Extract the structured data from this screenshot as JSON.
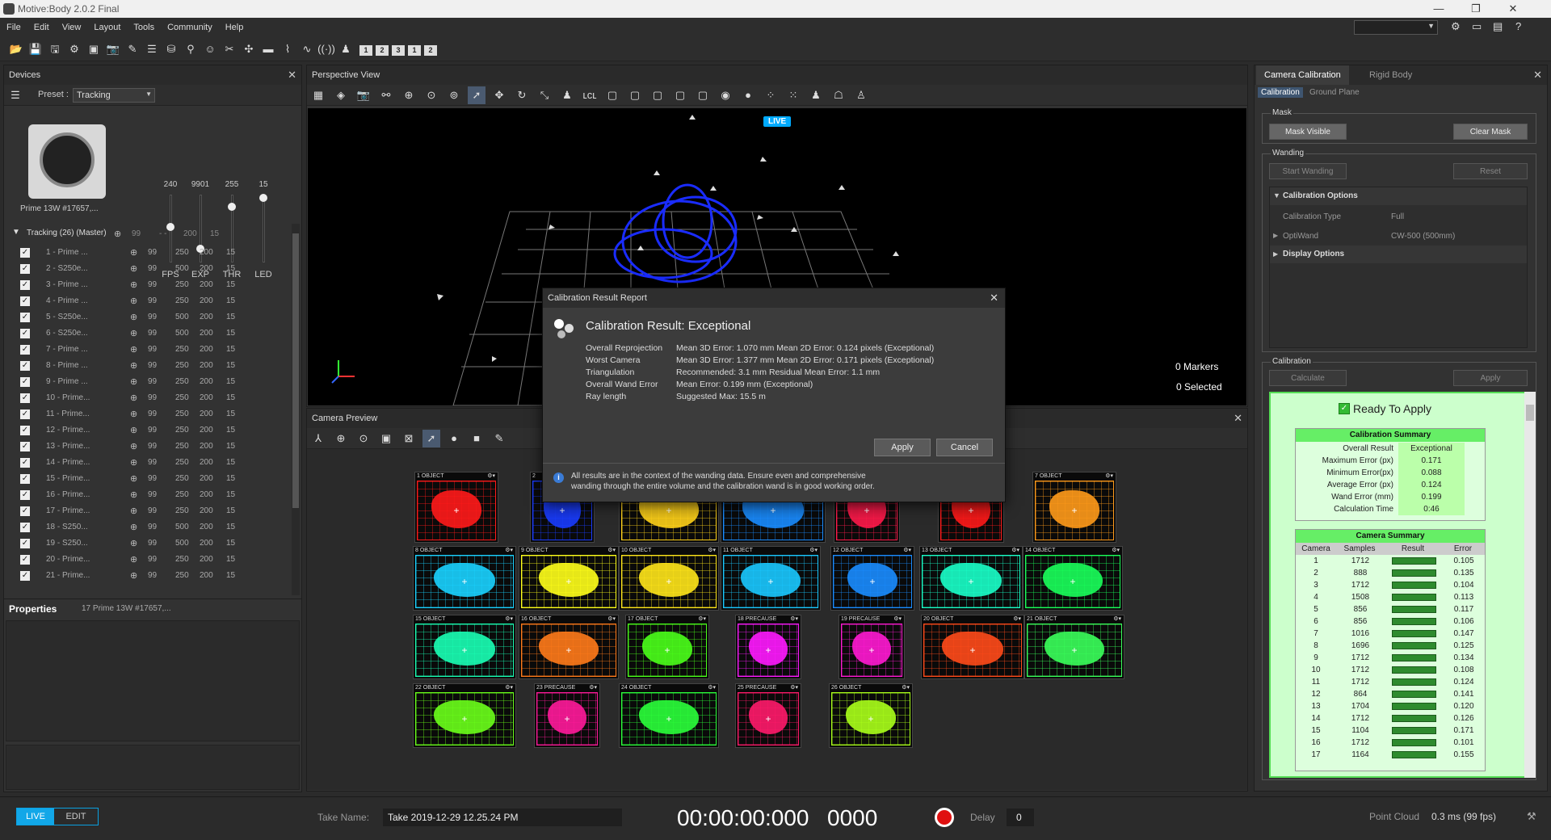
{
  "window": {
    "title": "Motive:Body 2.0.2 Final"
  },
  "menu": [
    "File",
    "Edit",
    "View",
    "Layout",
    "Tools",
    "Community",
    "Help"
  ],
  "toolbar_numbers": [
    "1",
    "2",
    "3",
    "1",
    "2"
  ],
  "devices": {
    "title": "Devices",
    "preset_label": "Preset :",
    "preset_value": "Tracking",
    "camera_name": "Prime 13W #17657,...",
    "sliders": [
      {
        "label": "FPS",
        "value": "240",
        "level": 0.52
      },
      {
        "label": "EXP",
        "value": "9901",
        "level": 0.2
      },
      {
        "label": "THR",
        "value": "255",
        "level": 0.82
      },
      {
        "label": "LED",
        "value": "15",
        "level": 0.95
      }
    ],
    "group_label": "Tracking (26) (Master)",
    "group_cols": [
      "99",
      "- -",
      "200",
      "15"
    ],
    "rows": [
      {
        "name": "1 - Prime ...",
        "fps": "99",
        "exp": "250",
        "thr": "200",
        "led": "15"
      },
      {
        "name": "2 - S250e...",
        "fps": "99",
        "exp": "500",
        "thr": "200",
        "led": "15"
      },
      {
        "name": "3 - Prime ...",
        "fps": "99",
        "exp": "250",
        "thr": "200",
        "led": "15"
      },
      {
        "name": "4 - Prime ...",
        "fps": "99",
        "exp": "250",
        "thr": "200",
        "led": "15"
      },
      {
        "name": "5 - S250e...",
        "fps": "99",
        "exp": "500",
        "thr": "200",
        "led": "15"
      },
      {
        "name": "6 - S250e...",
        "fps": "99",
        "exp": "500",
        "thr": "200",
        "led": "15"
      },
      {
        "name": "7 - Prime ...",
        "fps": "99",
        "exp": "250",
        "thr": "200",
        "led": "15"
      },
      {
        "name": "8 - Prime ...",
        "fps": "99",
        "exp": "250",
        "thr": "200",
        "led": "15"
      },
      {
        "name": "9 - Prime ...",
        "fps": "99",
        "exp": "250",
        "thr": "200",
        "led": "15"
      },
      {
        "name": "10 - Prime...",
        "fps": "99",
        "exp": "250",
        "thr": "200",
        "led": "15"
      },
      {
        "name": "11 - Prime...",
        "fps": "99",
        "exp": "250",
        "thr": "200",
        "led": "15"
      },
      {
        "name": "12 - Prime...",
        "fps": "99",
        "exp": "250",
        "thr": "200",
        "led": "15"
      },
      {
        "name": "13 - Prime...",
        "fps": "99",
        "exp": "250",
        "thr": "200",
        "led": "15"
      },
      {
        "name": "14 - Prime...",
        "fps": "99",
        "exp": "250",
        "thr": "200",
        "led": "15"
      },
      {
        "name": "15 - Prime...",
        "fps": "99",
        "exp": "250",
        "thr": "200",
        "led": "15"
      },
      {
        "name": "16 - Prime...",
        "fps": "99",
        "exp": "250",
        "thr": "200",
        "led": "15"
      },
      {
        "name": "17 - Prime...",
        "fps": "99",
        "exp": "250",
        "thr": "200",
        "led": "15"
      },
      {
        "name": "18 - S250...",
        "fps": "99",
        "exp": "500",
        "thr": "200",
        "led": "15"
      },
      {
        "name": "19 - S250...",
        "fps": "99",
        "exp": "500",
        "thr": "200",
        "led": "15"
      },
      {
        "name": "20 - Prime...",
        "fps": "99",
        "exp": "250",
        "thr": "200",
        "led": "15"
      },
      {
        "name": "21 - Prime...",
        "fps": "99",
        "exp": "250",
        "thr": "200",
        "led": "15"
      }
    ]
  },
  "properties": {
    "title": "Properties",
    "subject": "17 Prime 13W #17657,..."
  },
  "perspective": {
    "title": "Perspective View",
    "live_badge": "LIVE",
    "markers": "0 Markers",
    "selected": "0 Selected"
  },
  "camera_preview": {
    "title": "Camera Preview",
    "tiles": [
      {
        "id": "1",
        "tag": "OBJECT",
        "color": "#ff1a1a"
      },
      {
        "id": "2",
        "tag": "",
        "color": "#1a3cff"
      },
      {
        "id": "3",
        "tag": "",
        "color": "#ffd21a"
      },
      {
        "id": "4",
        "tag": "",
        "color": "#1a8cff"
      },
      {
        "id": "5",
        "tag": "",
        "color": "#ff1a4a"
      },
      {
        "id": "6",
        "tag": "",
        "color": "#ff1a1a"
      },
      {
        "id": "7",
        "tag": "OBJECT",
        "color": "#ff9a1a"
      },
      {
        "id": "8",
        "tag": "OBJECT",
        "color": "#1ad2ff"
      },
      {
        "id": "9",
        "tag": "OBJECT",
        "color": "#ffff1a"
      },
      {
        "id": "10",
        "tag": "OBJECT",
        "color": "#ffe61a"
      },
      {
        "id": "11",
        "tag": "OBJECT",
        "color": "#1ac8ff"
      },
      {
        "id": "12",
        "tag": "OBJECT",
        "color": "#1a8cff"
      },
      {
        "id": "13",
        "tag": "OBJECT",
        "color": "#1affc8"
      },
      {
        "id": "14",
        "tag": "OBJECT",
        "color": "#1aff5a"
      },
      {
        "id": "15",
        "tag": "OBJECT",
        "color": "#1affb4"
      },
      {
        "id": "16",
        "tag": "OBJECT",
        "color": "#ff7a1a"
      },
      {
        "id": "17",
        "tag": "OBJECT",
        "color": "#4aff1a"
      },
      {
        "id": "18",
        "tag": "PRECAUSE",
        "color": "#ff1aff"
      },
      {
        "id": "19",
        "tag": "PRECAUSE",
        "color": "#ff1ad2"
      },
      {
        "id": "20",
        "tag": "OBJECT",
        "color": "#ff4a1a"
      },
      {
        "id": "21",
        "tag": "OBJECT",
        "color": "#3aff5a"
      },
      {
        "id": "22",
        "tag": "OBJECT",
        "color": "#6aff1a"
      },
      {
        "id": "23",
        "tag": "PRECAUSE",
        "color": "#ff1a9a"
      },
      {
        "id": "24",
        "tag": "OBJECT",
        "color": "#2aff3a"
      },
      {
        "id": "25",
        "tag": "PRECAUSE",
        "color": "#ff1a6a"
      },
      {
        "id": "26",
        "tag": "OBJECT",
        "color": "#aaff1a"
      }
    ]
  },
  "dialog": {
    "title": "Calibration Result Report",
    "heading": "Calibration Result: Exceptional",
    "rows": [
      [
        "Overall Reprojection",
        "Mean 3D Error: 1.070 mm  Mean 2D Error: 0.124 pixels (Exceptional)"
      ],
      [
        "Worst Camera",
        "Mean 3D Error: 1.377 mm  Mean 2D Error: 0.171 pixels (Exceptional)"
      ],
      [
        "Triangulation",
        "Recommended: 3.1 mm    Residual Mean Error: 1.1 mm"
      ],
      [
        "Overall Wand Error",
        "Mean Error: 0.199 mm     (Exceptional)"
      ],
      [
        "Ray length",
        "Suggested Max: 15.5 m"
      ]
    ],
    "apply": "Apply",
    "cancel": "Cancel",
    "note": "All results are in the context of the wanding data.  Ensure even and comprehensive wanding through the entire volume and the calibration wand is in good working order."
  },
  "calibration_panel": {
    "tabs": [
      "Camera Calibration",
      "Rigid Body"
    ],
    "subtabs": [
      "Calibration",
      "Ground Plane"
    ],
    "mask_label": "Mask",
    "mask_visible": "Mask Visible",
    "clear_mask": "Clear Mask",
    "wanding_label": "Wanding",
    "start_wanding": "Start Wanding",
    "reset": "Reset",
    "calib_options": "Calibration Options",
    "calib_type_label": "Calibration Type",
    "calib_type_value": "Full",
    "optiwand_label": "OptiWand",
    "optiwand_value": "CW-500 (500mm)",
    "display_options": "Display Options",
    "calibration_label": "Calibration",
    "calculate": "Calculate",
    "apply": "Apply",
    "ready": "Ready To Apply",
    "summary_title": "Calibration Summary",
    "summary": [
      [
        "Overall Result",
        "Exceptional"
      ],
      [
        "Maximum Error (px)",
        "0.171"
      ],
      [
        "Minimum Error(px)",
        "0.088"
      ],
      [
        "Average Error (px)",
        "0.124"
      ],
      [
        "Wand Error (mm)",
        "0.199"
      ],
      [
        "Calculation Time",
        "0:46"
      ]
    ],
    "camera_summary_title": "Camera Summary",
    "camera_cols": [
      "Camera",
      "Samples",
      "Result",
      "Error"
    ],
    "cameras": [
      [
        "1",
        "1712",
        "0.105"
      ],
      [
        "2",
        "888",
        "0.135"
      ],
      [
        "3",
        "1712",
        "0.104"
      ],
      [
        "4",
        "1508",
        "0.113"
      ],
      [
        "5",
        "856",
        "0.117"
      ],
      [
        "6",
        "856",
        "0.106"
      ],
      [
        "7",
        "1016",
        "0.147"
      ],
      [
        "8",
        "1696",
        "0.125"
      ],
      [
        "9",
        "1712",
        "0.134"
      ],
      [
        "10",
        "1712",
        "0.108"
      ],
      [
        "11",
        "1712",
        "0.124"
      ],
      [
        "12",
        "864",
        "0.141"
      ],
      [
        "13",
        "1704",
        "0.120"
      ],
      [
        "14",
        "1712",
        "0.126"
      ],
      [
        "15",
        "1104",
        "0.171"
      ],
      [
        "16",
        "1712",
        "0.101"
      ],
      [
        "17",
        "1164",
        "0.155"
      ]
    ]
  },
  "status": {
    "live": "LIVE",
    "edit": "EDIT",
    "take_label": "Take Name:",
    "take_value": "Take 2019-12-29 12.25.24 PM",
    "timecode": "00:00:00:000",
    "frame": "0000",
    "delay_label": "Delay",
    "delay_value": "0",
    "pc_label": "Point Cloud",
    "pc_value": "0.3 ms (99 fps)"
  }
}
